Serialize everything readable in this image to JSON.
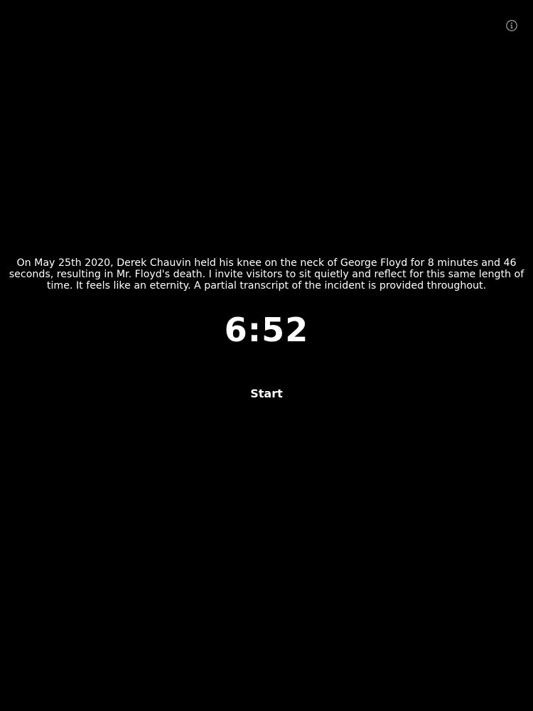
{
  "colors": {
    "background": "#000000",
    "text": "#ffffff",
    "icon": "#9a9a9a"
  },
  "header": {
    "info_icon": "info-icon"
  },
  "main": {
    "message": "On May 25th 2020, Derek Chauvin held his knee on the neck of George Floyd for 8 minutes and 46 seconds, resulting in Mr. Floyd's death. I invite visitors to sit quietly and reflect for this same length of time. It feels like an eternity. A partial transcript of the incident is provided throughout.",
    "timer": "6:52",
    "start_label": "Start"
  }
}
